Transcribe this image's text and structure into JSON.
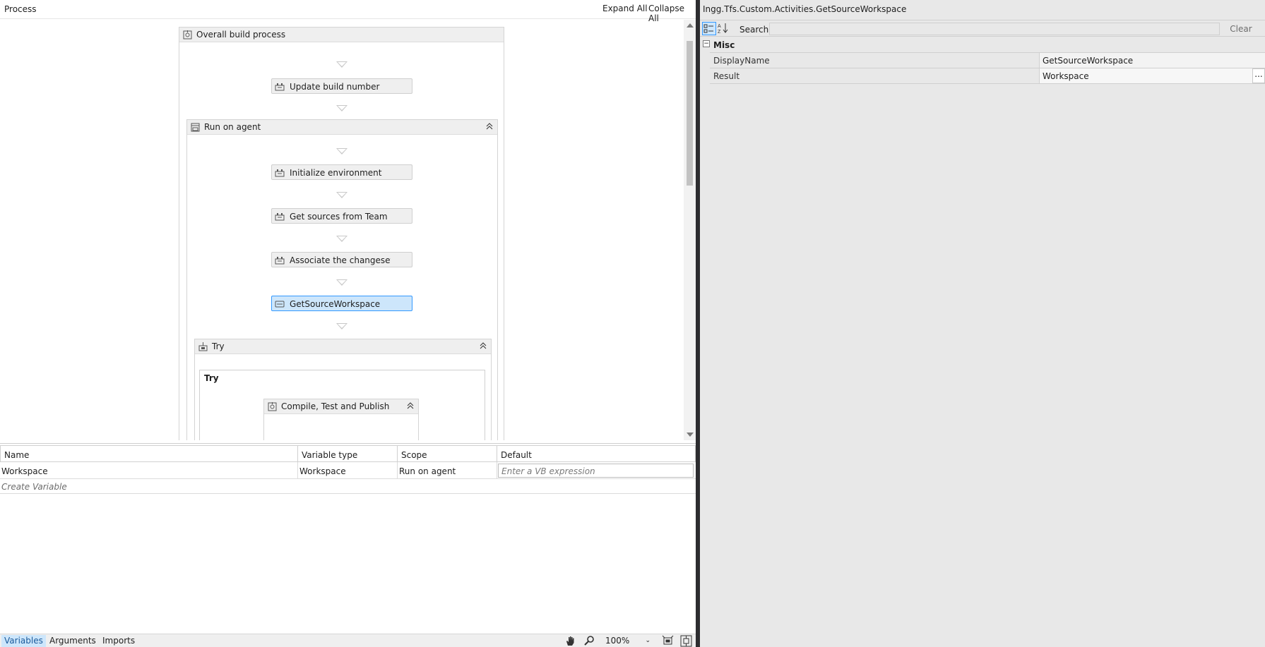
{
  "designer": {
    "breadcrumb": "Process",
    "expand_all": "Expand All",
    "collapse_all": "Collapse All"
  },
  "workflow": {
    "root": "Overall build process",
    "update_build_number": "Update build number",
    "run_on_agent": "Run on agent",
    "initialize_environment": "Initialize environment",
    "get_sources": "Get sources from Team Foundation Server",
    "associate_changesets": "Associate the changesets that occurred since the last good build",
    "get_source_workspace": "GetSourceWorkspace",
    "try_header": "Try",
    "try_inner": "Try",
    "compile_test_publish": "Compile, Test and Publish"
  },
  "variables": {
    "headers": [
      "Name",
      "Variable type",
      "Scope",
      "Default"
    ],
    "rows": [
      {
        "name": "Workspace",
        "type": "Workspace",
        "scope": "Run on agent",
        "default_placeholder": "Enter a VB expression"
      }
    ],
    "create_variable": "Create Variable"
  },
  "bottom_bar": {
    "tabs": [
      "Variables",
      "Arguments",
      "Imports"
    ],
    "active_tab": "Variables",
    "zoom": "100%"
  },
  "properties": {
    "title": "Ingg.Tfs.Custom.Activities.GetSourceWorkspace",
    "search_label": "Search:",
    "search_value": "",
    "clear_label": "Clear",
    "category": "Misc",
    "rows": [
      {
        "name": "DisplayName",
        "value": "GetSourceWorkspace"
      },
      {
        "name": "Result",
        "value": "Workspace"
      }
    ],
    "ellipsis": "..."
  },
  "colors": {
    "selected_fill": "#cde6fb",
    "selected_border": "#3399ff",
    "properties_bg": "#e8e8e8"
  }
}
